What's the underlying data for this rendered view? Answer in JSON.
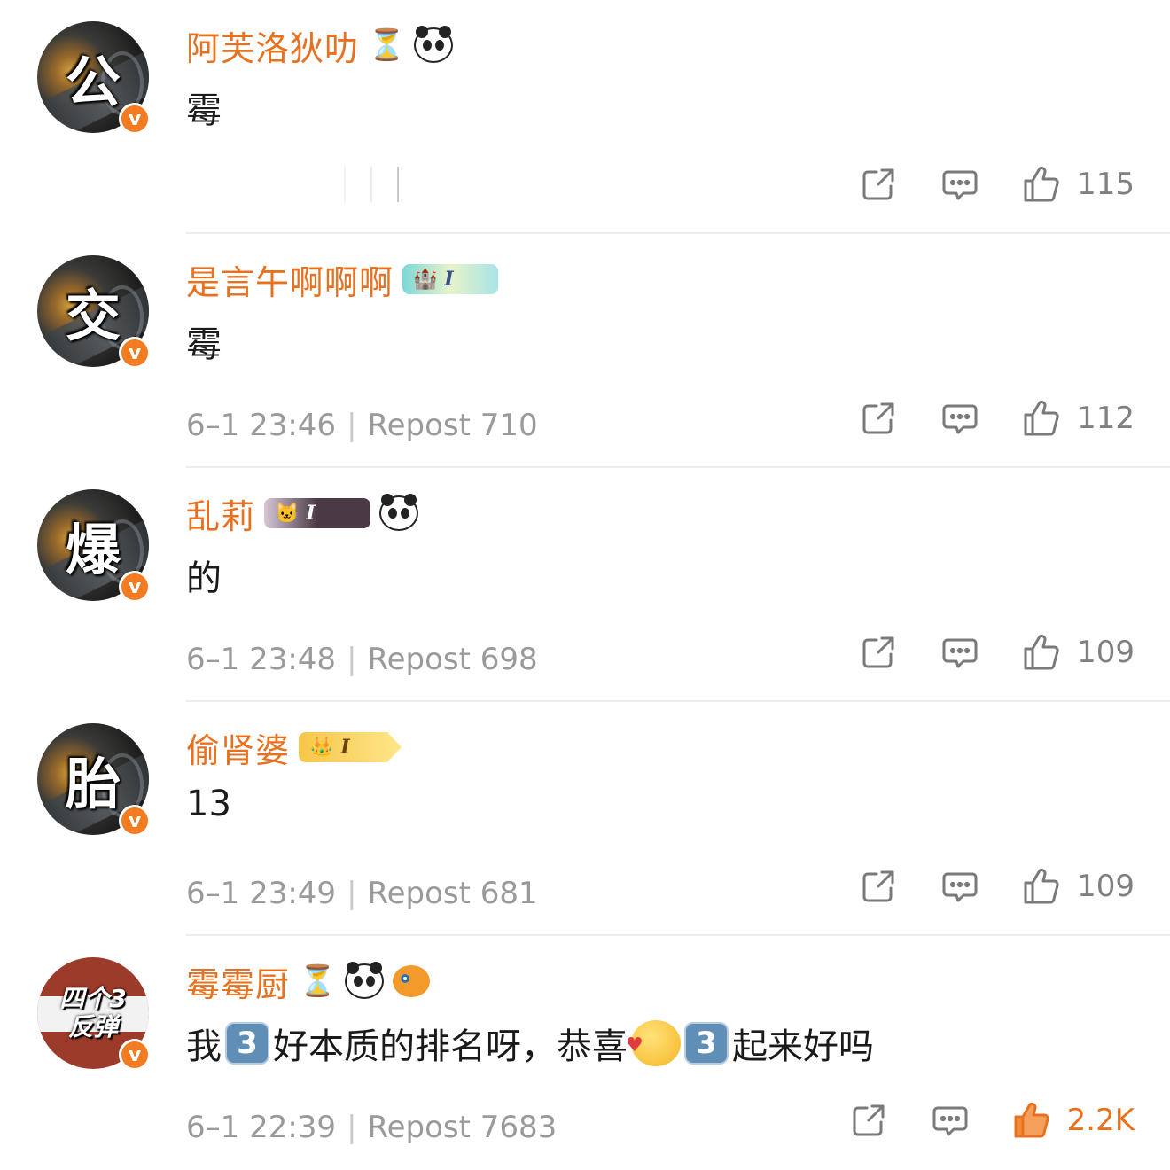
{
  "comments": [
    {
      "avatar_char": "公",
      "username": "阿芙洛狄叻",
      "badges": [
        "hourglass",
        "panda"
      ],
      "text": "霉",
      "time": "",
      "repost": "",
      "likes": "115",
      "liked": false
    },
    {
      "avatar_char": "交",
      "username": "是言午啊啊啊",
      "badges": [
        "level-teal"
      ],
      "level": "I",
      "text": "霉",
      "time": "6–1 23:46",
      "repost": "Repost 710",
      "likes": "112",
      "liked": false
    },
    {
      "avatar_char": "爆",
      "username": "乱莉",
      "badges": [
        "level-dark",
        "panda"
      ],
      "level": "I",
      "text": "的",
      "time": "6–1 23:48",
      "repost": "Repost 698",
      "likes": "109",
      "liked": false
    },
    {
      "avatar_char": "胎",
      "username": "偷肾婆",
      "badges": [
        "level-gold"
      ],
      "level": "I",
      "text": "13",
      "time": "6–1 23:49",
      "repost": "Repost 681",
      "likes": "109",
      "liked": false
    },
    {
      "avatar_lines": [
        "四个3",
        "反弹"
      ],
      "username": "霉霉厨",
      "badges": [
        "hourglass",
        "panda",
        "fish"
      ],
      "text_parts": [
        "我",
        "好本质的排名呀，恭喜",
        "起来好吗"
      ],
      "emoji_three": "3",
      "time": "6–1 22:39",
      "repost": "Repost 7683",
      "likes": "2.2K",
      "liked": true
    }
  ],
  "verified_mark": "v",
  "separator": "|",
  "colors": {
    "username": "#e8711f",
    "verified": "#f47b20",
    "meta": "#9a9a9a",
    "like_active": "#e8711f",
    "divider": "#ececec"
  },
  "icons": [
    "share-icon",
    "comment-icon",
    "like-icon",
    "hourglass-icon",
    "panda-icon",
    "fish-icon",
    "crown-icon",
    "level-badge-icon",
    "verified-icon"
  ]
}
